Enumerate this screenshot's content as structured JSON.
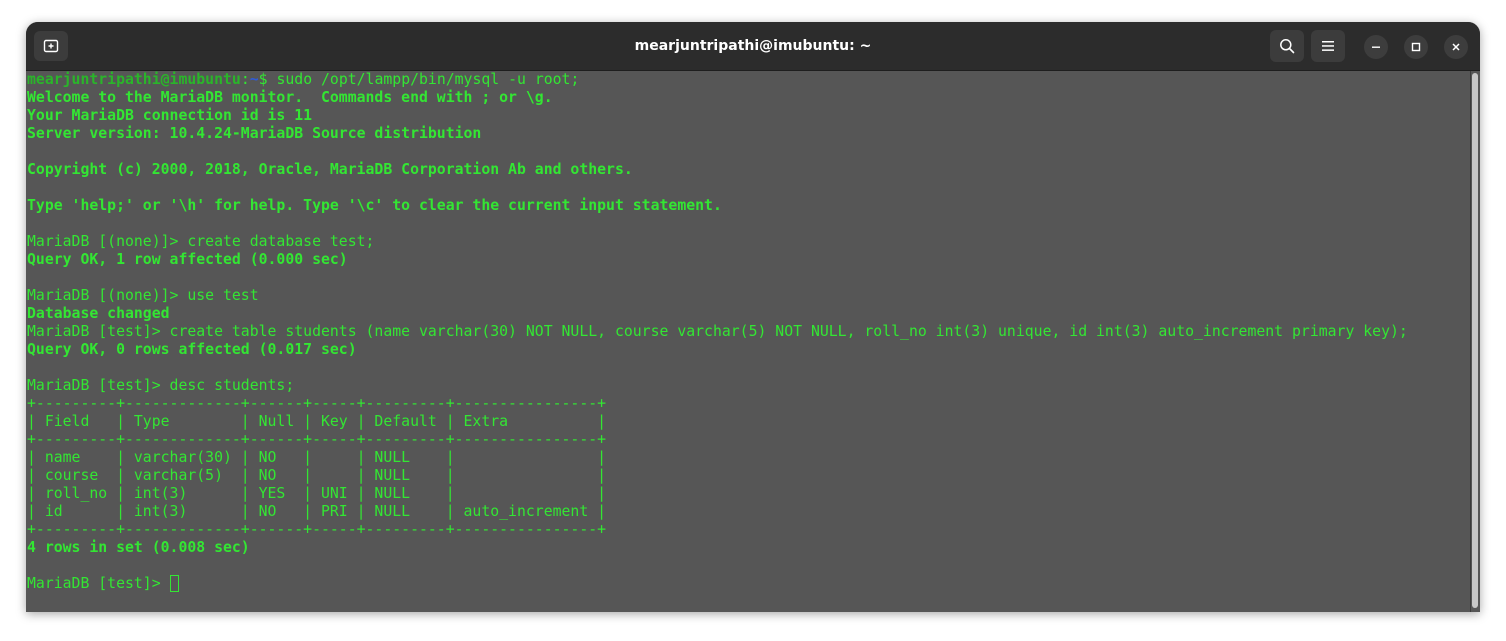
{
  "window": {
    "title": "mearjuntripathi@imubuntu: ~"
  },
  "icons": {
    "new_tab": "new-tab-icon",
    "search": "search-icon",
    "menu": "hamburger-menu-icon",
    "minimize": "minimize-icon",
    "maximize": "maximize-icon",
    "close": "close-icon"
  },
  "colors": {
    "terminal_bg": "#565656",
    "text_green": "#33e633",
    "titlebar_bg": "#2c2c2c"
  },
  "terminal": {
    "prompt_user": "mearjuntripathi@imubuntu",
    "prompt_sep": ":",
    "prompt_dir": "~",
    "prompt_cmd": "$ sudo /opt/lampp/bin/mysql -u root;",
    "lines": [
      "Welcome to the MariaDB monitor.  Commands end with ; or \\g.",
      "Your MariaDB connection id is 11",
      "Server version: 10.4.24-MariaDB Source distribution",
      "",
      "Copyright (c) 2000, 2018, Oracle, MariaDB Corporation Ab and others.",
      "",
      "Type 'help;' or '\\h' for help. Type '\\c' to clear the current input statement.",
      "",
      "MariaDB [(none)]> create database test;",
      "Query OK, 1 row affected (0.000 sec)",
      "",
      "MariaDB [(none)]> use test",
      "Database changed",
      "MariaDB [test]> create table students (name varchar(30) NOT NULL, course varchar(5) NOT NULL, roll_no int(3) unique, id int(3) auto_increment primary key);",
      "Query OK, 0 rows affected (0.017 sec)",
      "",
      "MariaDB [test]> desc students;",
      "+---------+-------------+------+-----+---------+----------------+",
      "| Field   | Type        | Null | Key | Default | Extra          |",
      "+---------+-------------+------+-----+---------+----------------+",
      "| name    | varchar(30) | NO   |     | NULL    |                |",
      "| course  | varchar(5)  | NO   |     | NULL    |                |",
      "| roll_no | int(3)      | YES  | UNI | NULL    |                |",
      "| id      | int(3)      | NO   | PRI | NULL    | auto_increment |",
      "+---------+-------------+------+-----+---------+----------------+",
      "4 rows in set (0.008 sec)",
      "",
      "MariaDB [test]> "
    ]
  }
}
